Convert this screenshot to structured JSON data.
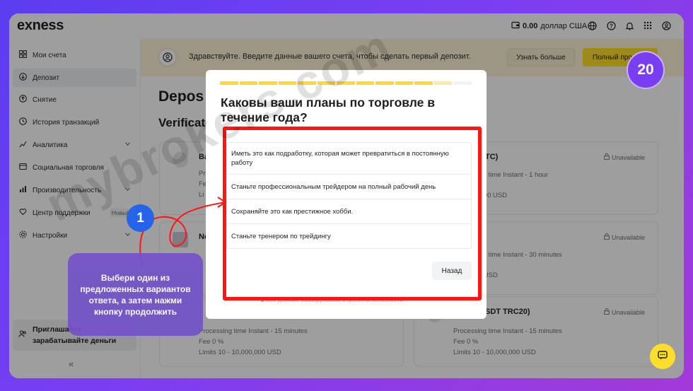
{
  "app": {
    "logo": "exness"
  },
  "topbar": {
    "balance": "0.00",
    "currency": "доллар США"
  },
  "sidebar": {
    "items": [
      {
        "label": "Мои счета",
        "icon": "grid-icon"
      },
      {
        "label": "Депозит",
        "icon": "deposit-icon"
      },
      {
        "label": "Снятие",
        "icon": "withdraw-icon"
      },
      {
        "label": "История транзакций",
        "icon": "history-icon"
      },
      {
        "label": "Аналитика",
        "icon": "analytics-icon"
      },
      {
        "label": "Социальная торговля",
        "icon": "social-icon"
      },
      {
        "label": "Производительность",
        "icon": "performance-icon"
      },
      {
        "label": "Центр поддержки",
        "icon": "heart-icon",
        "badge": "Новый"
      },
      {
        "label": "Настройки",
        "icon": "settings-icon"
      }
    ],
    "invite": {
      "line1": "Приглашайте",
      "line2": "зарабатывайте деньги"
    },
    "collapse": "«"
  },
  "banner": {
    "text": "Здравствуйте. Введите данные вашего счета, чтобы сделать первый депозит.",
    "learn_more": "Узнать больше",
    "full_profile": "Полный проф"
  },
  "main": {
    "title": "Depos",
    "section": "Verificat",
    "cards": [
      {
        "title": "Ba",
        "lines": [
          "Pr",
          "Fe",
          "Li"
        ],
        "status": ""
      },
      {
        "title": "TC)",
        "lines": [
          "Processing time Instant - 1 hour",
          "",
          "- 10,000,000 USD"
        ],
        "status": "Unavailable"
      },
      {
        "title": "Ne",
        "lines": [
          "",
          "",
          ""
        ],
        "status": ""
      },
      {
        "title": "",
        "lines": [
          "Processing time Instant - 30 minutes",
          "",
          "- 100,000 USD"
        ],
        "status": "Unavailable"
      },
      {
        "title": "",
        "lines": [
          "Processing time Instant - 15 minutes",
          "Fee 0 %",
          "Limits 10 - 10,000,000 USD"
        ],
        "status": ""
      },
      {
        "title": "SDT TRC20)",
        "lines": [
          "Processing time Instant - 15 minutes",
          "Fee 0 %",
          "Limits 10 - 10,000,000 USD"
        ],
        "status": "Unavailable"
      }
    ]
  },
  "modal": {
    "progress": {
      "total": 13,
      "completed": 11,
      "partial": 1
    },
    "title": "Каковы ваши планы по торговле в течение года?",
    "options": [
      "Иметь это как подработку, которая может превратиться в постоянную работу",
      "Станьте профессиональным трейдером на полный рабочий день",
      "Сохраняйте это как престижное хобби.",
      "Станьте тренером по трейдингу"
    ],
    "back": "Назад",
    "footer": "Все данные зашифрованы в целях безопасности"
  },
  "annotation": {
    "step": "1",
    "tooltip": "Выбери один из предложенных вариантов ответа, а затем нажми кнопку продолжить",
    "step_count": "20",
    "watermark": "mybrokers.com"
  },
  "colors": {
    "accent": "#ffdd2d",
    "highlight": "#ff1616",
    "annotation": "#7453c9",
    "step": "#2563eb"
  }
}
